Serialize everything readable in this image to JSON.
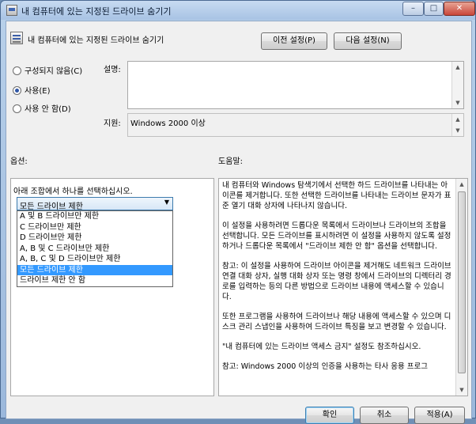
{
  "window": {
    "title": "내 컴퓨터에 있는 지정된 드라이브 숨기기",
    "controls": {
      "minimize": "–",
      "maximize": "□",
      "close": "✕"
    }
  },
  "header": {
    "setting_title": "내 컴퓨터에 있는 지정된 드라이브 숨기기",
    "prev_setting_label": "이전 설정(P)",
    "next_setting_label": "다음 설정(N)"
  },
  "state_options": [
    {
      "label": "구성되지 않음(C)",
      "checked": false
    },
    {
      "label": "사용(E)",
      "checked": true
    },
    {
      "label": "사용 안 함(D)",
      "checked": false
    }
  ],
  "description": {
    "label": "설명:",
    "value": ""
  },
  "support": {
    "label": "지원:",
    "value": "Windows 2000 이상"
  },
  "options": {
    "label": "옵션:",
    "prompt": "아래 조합에서 하나를 선택하십시오.",
    "selected": "모든 드라이브 제한",
    "items": [
      "A 및 B 드라이브만 제한",
      "C 드라이브만 제한",
      "D 드라이브만 제한",
      "A, B 및 C 드라이브만 제한",
      "A, B, C 및 D 드라이브만 제한",
      "모든 드라이브 제한",
      "드라이브 제한 안 함"
    ],
    "selected_index": 5
  },
  "help": {
    "label": "도움말:",
    "paragraphs": [
      "내 컴퓨터와 Windows 탐색기에서 선택한 하드 드라이브를 나타내는 아이콘를 제거합니다. 또한 선택한 드라이브를 나타내는 드라이브 문자가 표준 열기 대화 상자에 나타나지 않습니다.",
      "이 설정을 사용하려면 드롭다운 목록에서 드라이브나 드라이브의 조합을 선택합니다. 모든 드라이브를 표시하려면 이 설정을 사용하지 않도록 설정하거나 드롭다운 목록에서 \"드라이브 제한 안 함\" 옵션을 선택합니다.",
      "참고: 이 설정을 사용하여 드라이브 아이콘을 제거해도 네트워크 드라이브 연결 대화 상자, 실행 대화 상자 또는 명령 창에서 드라이브의 디렉터리 경로를 입력하는 등의 다른 방법으로 드라이브 내용에 액세스할 수 있습니다.",
      "또한 프로그램을 사용하여 드라이브나 해당 내용에 액세스할 수 있으며 디스크 관리 스냅인을 사용하여 드라이브 특징을 보고 변경할 수 있습니다.",
      "\"내 컴퓨터에 있는 드라이브 액세스 금지\" 설정도 참조하십시오.",
      "참고: Windows 2000 이상의 인증을 사용하는 타사 응용 프로그"
    ]
  },
  "footer": {
    "ok_label": "확인",
    "cancel_label": "취소",
    "apply_label": "적용(A)"
  },
  "icons": {
    "scroll_up": "▲",
    "scroll_down": "▼",
    "combo_arrow": "▼"
  }
}
